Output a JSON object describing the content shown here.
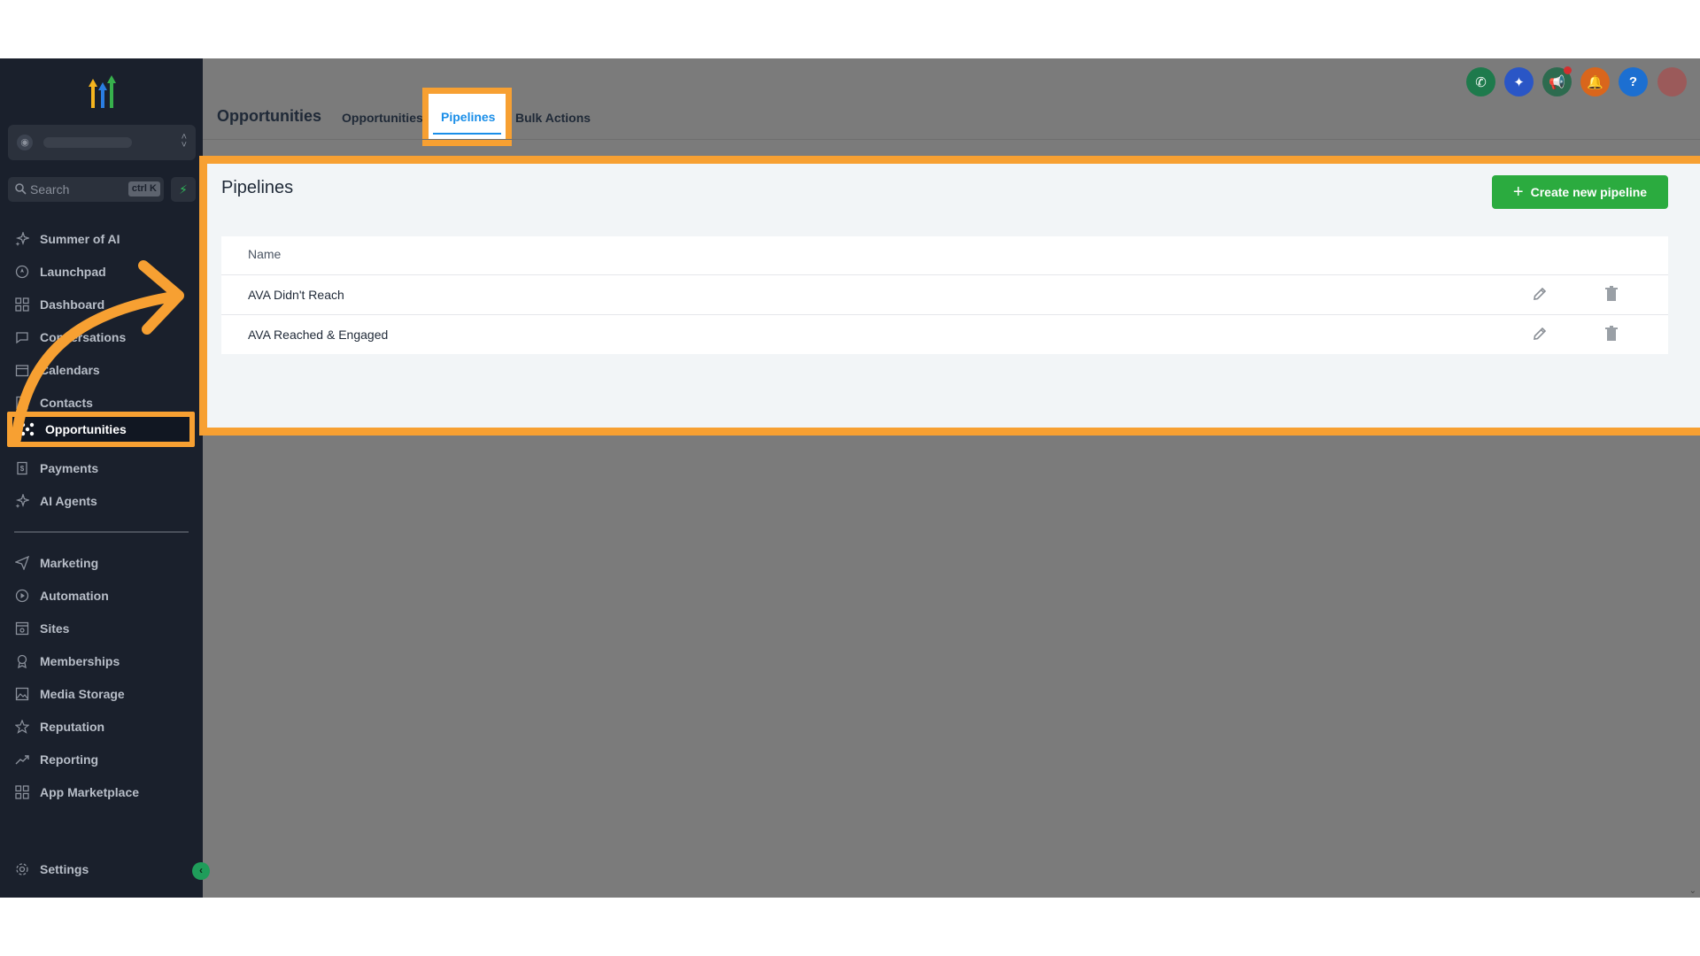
{
  "sidebar": {
    "search_placeholder": "Search",
    "search_shortcut": "ctrl K",
    "items": [
      {
        "label": "Summer of AI",
        "icon": "sparkle-icon"
      },
      {
        "label": "Launchpad",
        "icon": "rocket-icon"
      },
      {
        "label": "Dashboard",
        "icon": "grid-icon"
      },
      {
        "label": "Conversations",
        "icon": "chat-icon"
      },
      {
        "label": "Calendars",
        "icon": "calendar-icon"
      },
      {
        "label": "Contacts",
        "icon": "contacts-icon"
      },
      {
        "label": "Opportunities",
        "icon": "opportunities-icon"
      },
      {
        "label": "Payments",
        "icon": "payments-icon"
      },
      {
        "label": "AI Agents",
        "icon": "sparkle-icon"
      }
    ],
    "items2": [
      {
        "label": "Marketing",
        "icon": "send-icon"
      },
      {
        "label": "Automation",
        "icon": "automation-icon"
      },
      {
        "label": "Sites",
        "icon": "sites-icon"
      },
      {
        "label": "Memberships",
        "icon": "award-icon"
      },
      {
        "label": "Media Storage",
        "icon": "image-icon"
      },
      {
        "label": "Reputation",
        "icon": "star-icon"
      },
      {
        "label": "Reporting",
        "icon": "trend-icon"
      },
      {
        "label": "App Marketplace",
        "icon": "grid-icon"
      }
    ],
    "settings_label": "Settings"
  },
  "header": {
    "title": "Opportunities",
    "tabs": [
      "Opportunities",
      "Pipelines",
      "Bulk Actions"
    ],
    "active_tab": "Pipelines"
  },
  "panel": {
    "title": "Pipelines",
    "create_button": "Create new pipeline",
    "column_name": "Name",
    "rows": [
      "AVA Didn't Reach",
      "AVA Reached & Engaged"
    ]
  },
  "colors": {
    "highlight": "#f7a032",
    "primary_green": "#2bab3f",
    "active_tab": "#1a8ee8",
    "sidebar_bg": "#1a202c"
  }
}
